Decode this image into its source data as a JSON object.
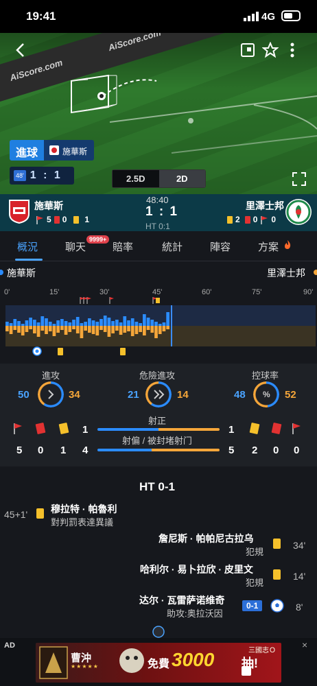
{
  "status_bar": {
    "time": "19:41",
    "network": "4G"
  },
  "pitch": {
    "watermark1": "AiScore.com",
    "watermark2": "AiScore.com",
    "event_label": "進球",
    "event_team": "施華斯",
    "minute_chip": "48'",
    "mini_home": "1",
    "mini_away": "1",
    "view_25d": "2.5D",
    "view_2d": "2D"
  },
  "scoreboard": {
    "home": "施華斯",
    "away": "里澤士邦",
    "clock": "48:40",
    "score": "1 : 1",
    "ht": "HT 0:1",
    "home_corners": "5",
    "home_reds": "0",
    "home_yellows": "1",
    "away_yellows": "2",
    "away_reds": "0",
    "away_corners": "0"
  },
  "tabs": [
    "概況",
    "聊天",
    "賠率",
    "統計",
    "陣容",
    "方案"
  ],
  "chat_badge": "9999+",
  "timeline": {
    "home": "施華斯",
    "away": "里澤士邦",
    "ticks": [
      "0'",
      "15'",
      "30'",
      "45'",
      "60'",
      "75'",
      "90'"
    ],
    "home_pressure": [
      6,
      4,
      10,
      7,
      3,
      8,
      12,
      9,
      5,
      14,
      11,
      6,
      3,
      8,
      10,
      7,
      5,
      9,
      13,
      4,
      6,
      11,
      8,
      6,
      10,
      15,
      12,
      7,
      9,
      5,
      14,
      8,
      11,
      6,
      4,
      17,
      12,
      9,
      6,
      3,
      5,
      20
    ],
    "away_pressure": [
      8,
      12,
      6,
      10,
      14,
      9,
      5,
      11,
      16,
      7,
      12,
      8,
      15,
      10,
      6,
      13,
      9,
      5,
      11,
      18,
      7,
      10,
      12,
      14,
      6,
      9,
      16,
      11,
      7,
      13,
      10,
      8,
      15,
      12,
      9,
      14,
      6,
      10,
      18,
      12,
      8,
      5
    ]
  },
  "stats": {
    "attack_label": "進攻",
    "dangerous_label": "危險進攻",
    "possession_label": "控球率",
    "attack_home": "50",
    "attack_away": "34",
    "dangerous_home": "21",
    "dangerous_away": "14",
    "possession_home": "48",
    "possession_away": "52",
    "possession_home_fraction": 0.48,
    "attack_home_fraction": 0.595,
    "dangerous_home_fraction": 0.6,
    "on_target_label": "射正",
    "off_target_label": "射偏 / 被封堵射门",
    "home_corners": "5",
    "home_reds": "0",
    "home_yellows": "1",
    "away_yellows": "2",
    "away_reds": "0",
    "away_corners": "0",
    "home_on_target": "1",
    "away_on_target": "1",
    "home_off_target": "4",
    "away_off_target": "5",
    "red_card_row_home": "1"
  },
  "events": {
    "ht_title": "HT 0-1",
    "list": [
      {
        "minute": "45+1'",
        "player": "穆拉特 · 帕魯利",
        "detail": "對判罰表達異議",
        "side": "home",
        "type": "yellow"
      },
      {
        "minute": "34'",
        "player": "詹尼斯 · 帕帕尼古拉乌",
        "detail": "犯規",
        "side": "away",
        "type": "yellow"
      },
      {
        "minute": "14'",
        "player": "哈利尔 · 易卜拉欣 · 皮里文",
        "detail": "犯規",
        "side": "away",
        "type": "yellow"
      },
      {
        "minute": "8'",
        "player": "达尔 · 瓦雷萨诺维奇",
        "detail": "助攻:奥拉沃因",
        "side": "away",
        "type": "goal",
        "score": "0-1"
      }
    ]
  },
  "ad": {
    "label": "AD",
    "close": "×",
    "game": "曹沖",
    "stars": "★★★★★",
    "free": "免費",
    "amount": "3000",
    "draw": "抽!",
    "brand": "三國志Ｏ"
  },
  "colors": {
    "accent": "#4aa3ff",
    "home": "#2b8cff",
    "away": "#f5a63a",
    "red": "#e23232",
    "yellow": "#f5c02b"
  }
}
